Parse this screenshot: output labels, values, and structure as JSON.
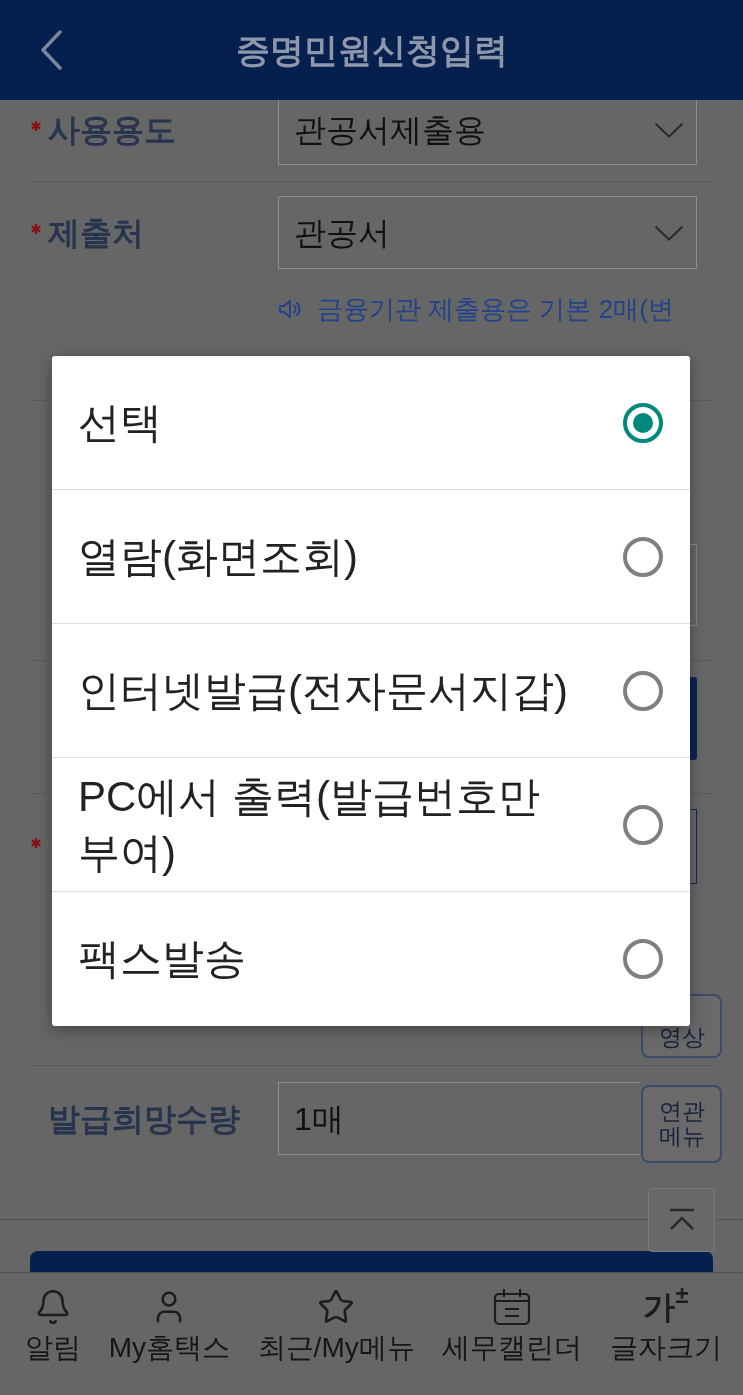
{
  "header": {
    "title": "증명민원신청입력"
  },
  "form": {
    "rows": [
      {
        "kind": "select",
        "required": true,
        "label": "사용용도",
        "value": "관공서제출용"
      },
      {
        "kind": "select",
        "required": true,
        "label": "제출처",
        "value": "관공서",
        "notice": "금융기관 제출용은 기본 2매(변"
      },
      {
        "kind": "covered_field",
        "required": false
      },
      {
        "kind": "covered_button",
        "required": false
      },
      {
        "kind": "covered_box",
        "required": true
      },
      {
        "kind": "input",
        "required": false,
        "label": "발급희망수량",
        "value": "1매"
      }
    ]
  },
  "side_buttons": [
    {
      "label": "영상"
    },
    {
      "label": "연관메뉴"
    }
  ],
  "dialog": {
    "options": [
      {
        "label": "선택",
        "selected": true
      },
      {
        "label": "열람(화면조회)",
        "selected": false
      },
      {
        "label": "인터넷발급(전자문서지갑)",
        "selected": false
      },
      {
        "label": "PC에서 출력(발급번호만 부여)",
        "selected": false
      },
      {
        "label": "팩스발송",
        "selected": false
      }
    ]
  },
  "bottom_nav": {
    "items": [
      {
        "label": "알림"
      },
      {
        "label": "My홈택스"
      },
      {
        "label": "최근/My메뉴"
      },
      {
        "label": "세무캘린더"
      },
      {
        "label": "글자크기",
        "glyph": "가$^{±}$"
      }
    ]
  }
}
